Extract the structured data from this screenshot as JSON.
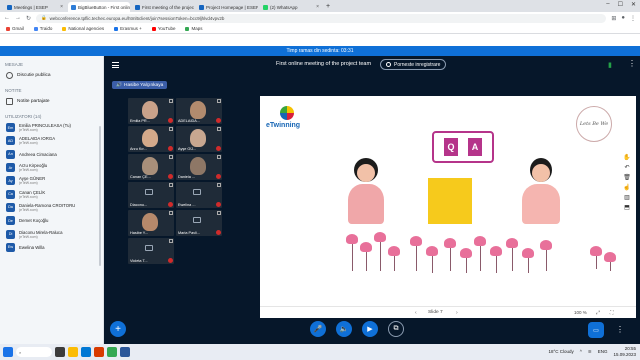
{
  "browser": {
    "tabs": [
      {
        "label": "Meetings | ESEP",
        "color": "#1565c0",
        "active": false
      },
      {
        "label": "BigBlueButton - First online...",
        "color": "#2e7dd7",
        "active": true
      },
      {
        "label": "First meeting of the project",
        "color": "#1565c0",
        "active": false
      },
      {
        "label": "Project Homepage | ESEP",
        "color": "#1565c0",
        "active": false
      },
      {
        "label": "(2) WhatsApp",
        "color": "#25d366",
        "active": false
      }
    ],
    "url": "webconference.tpflic.techec.europa.eu/html5client/join?sessionToken=bcc9ljhlvd4vpv2b",
    "bookmarks": [
      {
        "label": "Gmail",
        "color": "#ea4335"
      },
      {
        "label": "Traiđo",
        "color": "#4285f4"
      },
      {
        "label": "National agencies",
        "color": "#fbbc05"
      },
      {
        "label": "Erasmus +",
        "color": "#1a73e8"
      },
      {
        "label": "YouTube",
        "color": "#ff0000"
      },
      {
        "label": "Maps",
        "color": "#34a853"
      }
    ]
  },
  "meeting": {
    "timer_label": "Timp ramas din sedinta: 03:31",
    "title": "First online meeting of the project team",
    "record_label": "Porneste inregistrare",
    "talker": "Hasibe Yalçınkaya"
  },
  "sidebar": {
    "messages_heading": "MESAJE",
    "public_chat": "Discutie publica",
    "notes_heading": "NOTITE",
    "shared_notes": "Notite partajate",
    "users_heading": "UTILIZATORI (14)",
    "users": [
      {
        "name": "Emilia PRINCULEASA (Tu)",
        "sub": "(eTeW.xom)",
        "initials": "Em",
        "color": "#1e5aa8"
      },
      {
        "name": "ADELAIDA IORGA",
        "sub": "(eTeW.xom)",
        "initials": "AD",
        "color": "#1e5aa8"
      },
      {
        "name": "Andreea Cimaciana",
        "sub": "",
        "initials": "An",
        "color": "#1e5aa8"
      },
      {
        "name": "Arzu Kirpeoğlu",
        "sub": "(eTeW.xom)",
        "initials": "Ar",
        "color": "#1e5aa8"
      },
      {
        "name": "Ayşe GÜNER",
        "sub": "(eTeW.xom)",
        "initials": "Ay",
        "color": "#1e5aa8"
      },
      {
        "name": "Canan ÇELİK",
        "sub": "(eTeW.xom)",
        "initials": "Ca",
        "color": "#1e5aa8"
      },
      {
        "name": "Daniela-Ramona CROITORU",
        "sub": "(eTeW.xom)",
        "initials": "Da",
        "color": "#1e5aa8"
      },
      {
        "name": "Demet Koçoğlu",
        "sub": "",
        "initials": "De",
        "color": "#1e5aa8"
      },
      {
        "name": "Diaconu Mirela-Raluca",
        "sub": "(eTeW.xom)",
        "initials": "Di",
        "color": "#1e5aa8"
      },
      {
        "name": "Ewelina Willa",
        "sub": "",
        "initials": "Ew",
        "color": "#1e5aa8"
      }
    ]
  },
  "videos": [
    {
      "label": "Emilia PR...",
      "muted": true,
      "cam": true,
      "face": "#c9a28a"
    },
    {
      "label": "ADELAIDA...",
      "muted": true,
      "cam": true,
      "face": "#b28b6e"
    },
    {
      "label": "Arzu Kır...",
      "muted": true,
      "cam": true,
      "face": "#d3a98a"
    },
    {
      "label": "Ayşe GÜ...",
      "muted": true,
      "cam": true,
      "face": "#c8a790"
    },
    {
      "label": "Canan ÇE...",
      "muted": true,
      "cam": true,
      "face": "#a88f7a"
    },
    {
      "label": "Daniela ...",
      "muted": true,
      "cam": true,
      "face": "#8e7766"
    },
    {
      "label": "Diaconu...",
      "muted": true,
      "cam": false,
      "face": ""
    },
    {
      "label": "Ewelina ...",
      "muted": true,
      "cam": false,
      "face": ""
    },
    {
      "label": "Hasibe Y...",
      "muted": false,
      "cam": true,
      "face": "#b6896b"
    },
    {
      "label": "Maria Pavli...",
      "muted": true,
      "cam": false,
      "face": ""
    },
    {
      "label": "Violeta T...",
      "muted": true,
      "cam": false,
      "face": ""
    }
  ],
  "slide": {
    "etwinning_label": "eTwinning",
    "logo_text": "Lets Be We",
    "slide_label": "Slide 7",
    "zoom_label": "100 %",
    "qa_letters": [
      "Q",
      "A"
    ]
  },
  "taskbar": {
    "weather": "18°C  Cloudy",
    "lang": "ENG",
    "time": "20:55",
    "date": "15.09.2023"
  },
  "colors": {
    "accent": "#0f70d7",
    "app_bg": "#06172a",
    "qa_magenta": "#b5348a",
    "slide_yellow": "#f6ca1c"
  }
}
